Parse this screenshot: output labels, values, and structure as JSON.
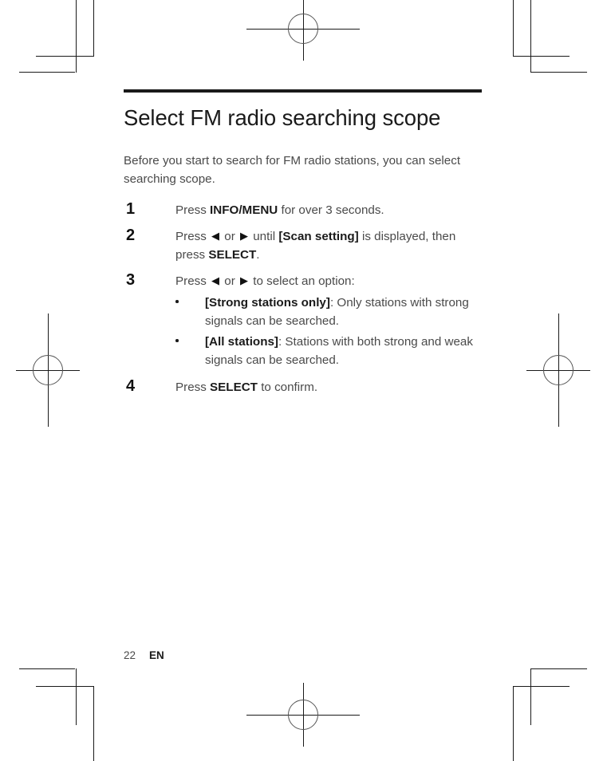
{
  "document": {
    "title": "Select FM radio searching scope",
    "intro": "Before you start to search for FM radio stations, you can select searching scope.",
    "steps": [
      {
        "number": "1",
        "parts": [
          {
            "text": "Press ",
            "bold": false
          },
          {
            "text": "INFO/MENU",
            "bold": true
          },
          {
            "text": " for over 3 seconds.",
            "bold": false
          }
        ]
      },
      {
        "number": "2",
        "parts": [
          {
            "text": "Press ",
            "bold": false
          },
          {
            "text": "◀",
            "icon": "left-arrow-icon"
          },
          {
            "text": " or ",
            "bold": false
          },
          {
            "text": "▶",
            "icon": "right-arrow-icon"
          },
          {
            "text": " until ",
            "bold": false
          },
          {
            "text": "[Scan setting]",
            "bold": true
          },
          {
            "text": " is displayed, then press ",
            "bold": false
          },
          {
            "text": "SELECT",
            "bold": true
          },
          {
            "text": ".",
            "bold": false
          }
        ]
      },
      {
        "number": "3",
        "parts": [
          {
            "text": "Press ",
            "bold": false
          },
          {
            "text": "◀",
            "icon": "left-arrow-icon"
          },
          {
            "text": " or ",
            "bold": false
          },
          {
            "text": "▶",
            "icon": "right-arrow-icon"
          },
          {
            "text": " to select an option:",
            "bold": false
          }
        ],
        "bullets": [
          {
            "parts": [
              {
                "text": "[Strong stations only]",
                "bold": true
              },
              {
                "text": ": Only stations with strong signals can be searched.",
                "bold": false
              }
            ]
          },
          {
            "parts": [
              {
                "text": "[All stations]",
                "bold": true
              },
              {
                "text": ": Stations with both strong and weak signals can be searched.",
                "bold": false
              }
            ]
          }
        ]
      },
      {
        "number": "4",
        "parts": [
          {
            "text": "Press ",
            "bold": false
          },
          {
            "text": "SELECT",
            "bold": true
          },
          {
            "text": " to confirm.",
            "bold": false
          }
        ]
      }
    ]
  },
  "footer": {
    "page_number": "22",
    "language": "EN"
  },
  "colors": {
    "body_text": "#4a4a4a",
    "heading_text": "#1a1a1a",
    "rule": "#1a1a1a",
    "mark": "#1a1a1a",
    "registration_circle": "#555555"
  },
  "print_marks": {
    "corner_crop_marks": 4,
    "registration_marks": 4,
    "registration_icon": "registration-target-icon"
  }
}
